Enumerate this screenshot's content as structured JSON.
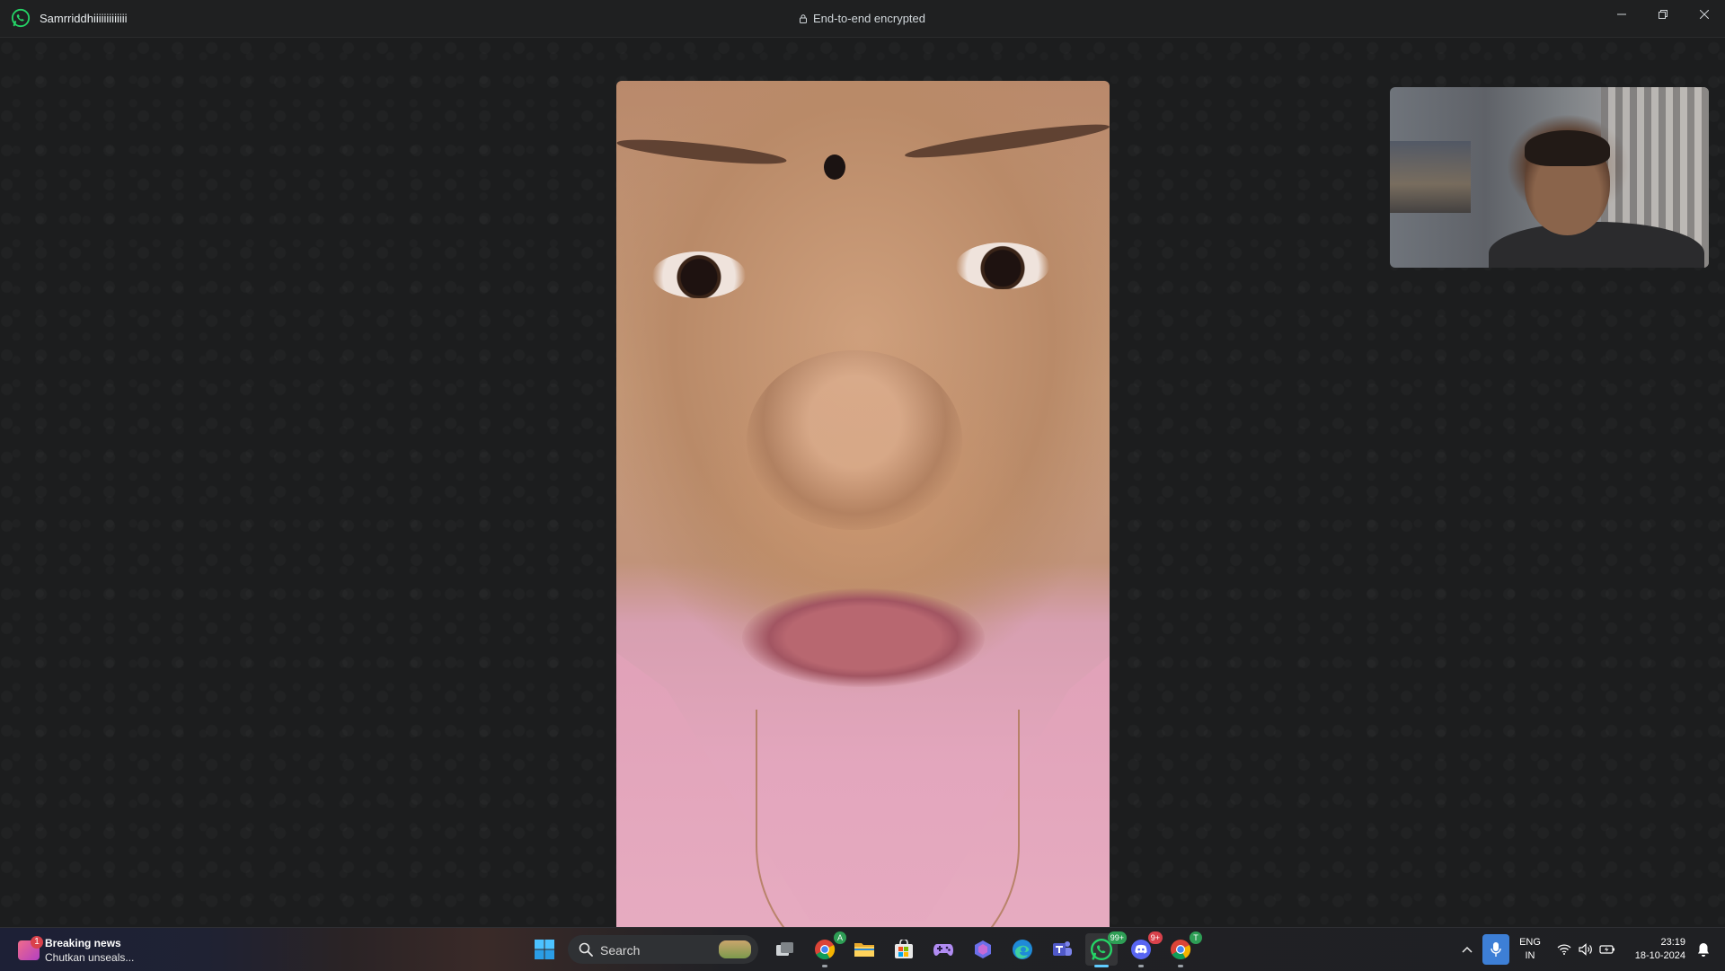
{
  "window": {
    "contact_name": "Samrriddhiiiiiiiiiiiii",
    "encryption_label": "End-to-end encrypted",
    "controls": [
      "minimize",
      "restore",
      "close"
    ]
  },
  "call": {
    "remote_video": "remote participant video",
    "self_video": "self preview"
  },
  "taskbar": {
    "news": {
      "badge": "1",
      "title": "Breaking news",
      "subtitle": "Chutkan unseals..."
    },
    "search_placeholder": "Search",
    "apps": [
      {
        "name": "start",
        "icon": "windows-logo-icon"
      },
      {
        "name": "task-view",
        "icon": "task-view-icon"
      },
      {
        "name": "chrome-profile",
        "icon": "chrome-icon",
        "badge": "A"
      },
      {
        "name": "file-explorer",
        "icon": "folder-icon"
      },
      {
        "name": "microsoft-store",
        "icon": "store-icon"
      },
      {
        "name": "game",
        "icon": "gamepad-icon"
      },
      {
        "name": "copilot",
        "icon": "copilot-icon"
      },
      {
        "name": "edge",
        "icon": "edge-icon"
      },
      {
        "name": "teams",
        "icon": "teams-icon"
      },
      {
        "name": "whatsapp",
        "icon": "whatsapp-icon",
        "badge": "99+",
        "active": true
      },
      {
        "name": "discord",
        "icon": "discord-icon",
        "badge": "9+"
      },
      {
        "name": "chrome",
        "icon": "chrome-icon",
        "badge": "T"
      }
    ],
    "language": {
      "line1": "ENG",
      "line2": "IN"
    },
    "time": "23:19",
    "date": "18-10-2024"
  },
  "colors": {
    "whatsapp_green": "#25d366",
    "badge_red": "#d9414b",
    "badge_green": "#2e9e55",
    "accent_blue": "#60cdff"
  }
}
